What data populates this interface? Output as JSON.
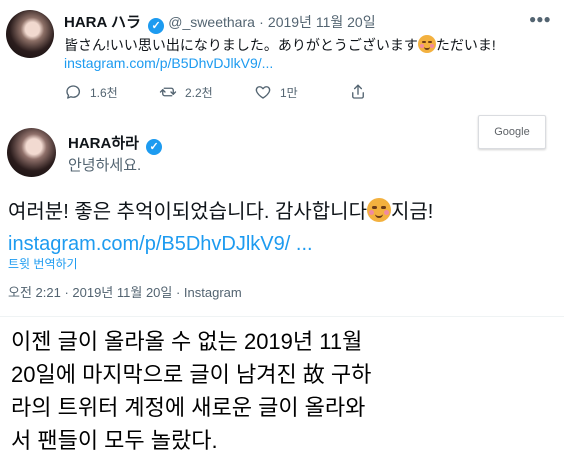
{
  "top_tweet": {
    "display_name": "HARA ハラ",
    "handle": "@_sweethara",
    "separator": "·",
    "date": "2019년 11월 20일",
    "text_before_emoji": "皆さん!いい思い出になりました。ありがとうございます",
    "text_after_emoji": "ただいま!",
    "link": "instagram.com/p/B5DhvDJlkV9/...",
    "more_icon": "more-icon",
    "actions": {
      "reply_count": "1.6천",
      "retweet_count": "2.2천",
      "like_count": "1만"
    }
  },
  "detail_tweet": {
    "display_name": "HARA하라",
    "subtitle": "안녕하세요.",
    "google_badge": "Google",
    "body_before_emoji": "여러분! 좋은 추억이되었습니다. 감사합니다",
    "body_after_emoji": "지금!",
    "link": "instagram.com/p/B5DhvDJlkV9/ ...",
    "translate": "트윗 번역하기",
    "timestamp": "오전 2:21 · 2019년 11월 20일 · Instagram"
  },
  "caption": "이젠 글이 올라올 수 없는 2019년 11월\n20일에 마지막으로 글이 남겨진 故 구하\n라의 트위터 계정에 새로운 글이 올라와\n서 팬들이 모두 놀랐다.",
  "colors": {
    "link": "#1d9bf0",
    "muted": "#536471",
    "verified": "#1d9bf0"
  }
}
